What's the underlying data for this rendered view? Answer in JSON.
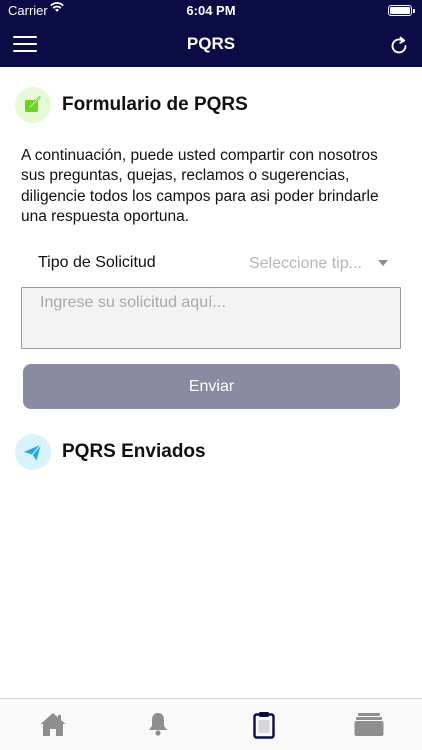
{
  "status_bar": {
    "carrier": "Carrier",
    "time": "6:04 PM"
  },
  "header": {
    "title": "PQRS"
  },
  "form_section": {
    "title": "Formulario de PQRS"
  },
  "intro_text": "A continuación, puede usted compartir con nosotros sus preguntas, quejas, reclamos o sugerencias, diligencie todos los campos para asi poder brindarle una respuesta oportuna.",
  "request_type": {
    "label": "Tipo de Solicitud",
    "selected": "Seleccione tip..."
  },
  "request_input": {
    "placeholder": "Ingrese su solicitud aquí..."
  },
  "send_button": {
    "label": "Enviar"
  },
  "sent_section": {
    "title": "PQRS Enviados"
  },
  "tabs": [
    {
      "icon": "home-icon",
      "active": false
    },
    {
      "icon": "bell-icon",
      "active": false
    },
    {
      "icon": "clipboard-icon",
      "active": true
    },
    {
      "icon": "stack-icon",
      "active": false
    }
  ],
  "colors": {
    "header_bg": "#0b0b45",
    "button_bg": "#8a8aa2",
    "active_tab": "#0b0b45",
    "inactive_tab": "#8e8e8e",
    "form_icon_bg": "#e6f8d4",
    "form_icon_fg": "#6bd61c",
    "sent_icon_bg": "#d7f3fb",
    "sent_icon_fg": "#22a8d8"
  }
}
